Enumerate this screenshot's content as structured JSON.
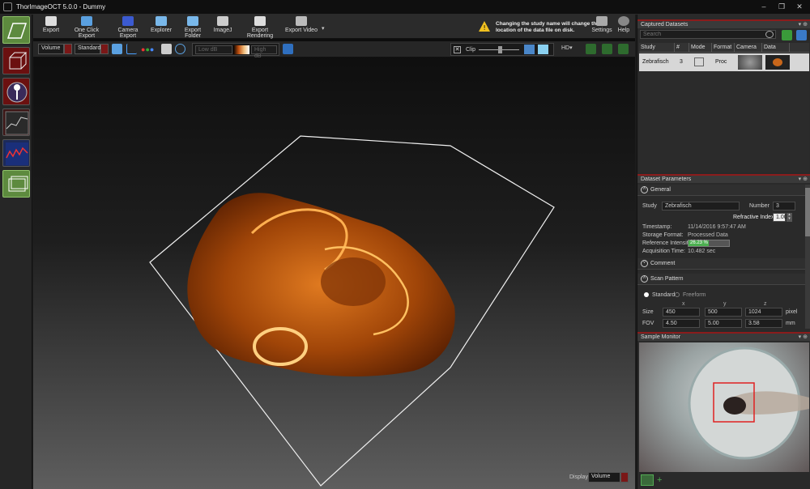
{
  "window": {
    "title": "ThorImageOCT 5.0.0 - Dummy"
  },
  "toolbar": {
    "buttons": [
      "Export",
      "One Click Export",
      "Camera Export",
      "Explorer",
      "Export Folder",
      "ImageJ",
      "Export Rendering",
      "Export Video"
    ],
    "warning": "Changing the study name will change the location of the data file on disk.",
    "settings": "Settings",
    "help": "Help"
  },
  "view_toolbar": {
    "render_mode": "Volume",
    "preset": "Standard",
    "low_db": "Low dB",
    "high_db": "High dB",
    "clip_label": "Clip"
  },
  "display": {
    "label": "Display",
    "value": "Volume"
  },
  "captured_datasets": {
    "title": "Captured Datasets",
    "search_placeholder": "Search",
    "columns": [
      "Study",
      "#",
      "Mode",
      "Format",
      "Camera",
      "Data"
    ],
    "rows": [
      {
        "study": "Zebrafisch",
        "number": "3",
        "format": "Proc"
      }
    ]
  },
  "dataset_parameters": {
    "title": "Dataset Parameters",
    "general_label": "General",
    "study_label": "Study",
    "study_value": "Zebrafisch",
    "number_label": "Number",
    "number_value": "3",
    "refractive_label": "Refractive Index",
    "refractive_value": "1.00",
    "timestamp_label": "Timestamp:",
    "timestamp_value": "11/14/2016 9:57:47 AM",
    "storage_label": "Storage Format:",
    "storage_value": "Processed Data",
    "ref_intensity_label": "Reference Intensity:",
    "ref_intensity_value": "26.23 %",
    "ref_intensity_fraction": 0.2623,
    "acq_label": "Acquisition Time:",
    "acq_value": "10.482 sec",
    "comment_label": "Comment",
    "scan_pattern_label": "Scan Pattern",
    "standard_label": "Standard",
    "freeform_label": "Freeform",
    "axes": [
      "x",
      "y",
      "z"
    ],
    "size_label": "Size",
    "size_values": [
      "450",
      "500",
      "1024"
    ],
    "size_unit": "pixel",
    "fov_label": "FOV",
    "fov_values": [
      "4.50",
      "5.00",
      "3.58"
    ],
    "fov_unit": "mm"
  },
  "sample_monitor": {
    "title": "Sample Monitor",
    "add": "+"
  },
  "colors": {
    "accent_red": "#8b1c1c",
    "orange": "#c8661a",
    "green": "#4caf50"
  }
}
